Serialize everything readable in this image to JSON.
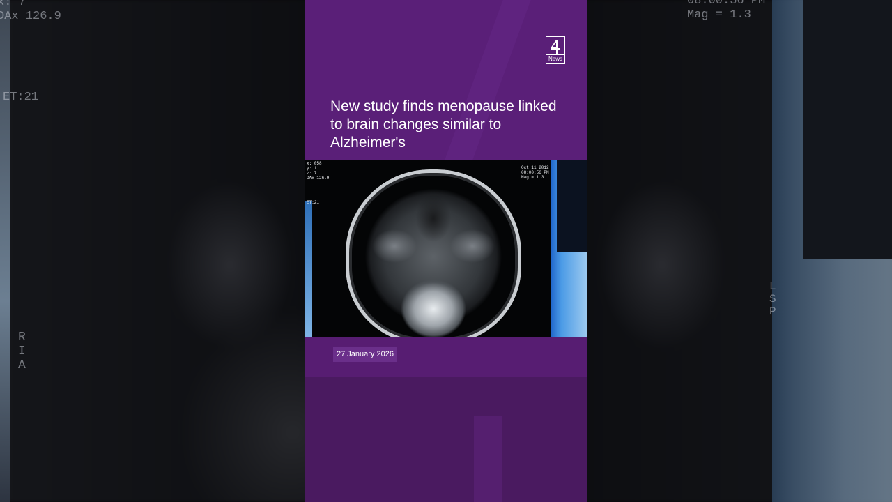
{
  "card": {
    "logo_text": "News",
    "headline": "New study finds menopause linked to brain changes similar to Alzheimer's",
    "date": "27 January 2026"
  },
  "image_overlay_text": {
    "top_left": "x: 058\ny: 11\nz: 7\nDAx 126.9",
    "left_mid": "ET:21",
    "top_right": "Oct 11 2012\n08:00:56 PM\nMag = 1.3"
  },
  "background_text": {
    "left_top": "x: 7\nDAx 126.9",
    "left_mid": "ET:21",
    "left_bottom": "R\nI\nA",
    "right_top": "08:00:56 PM\nMag = 1.3",
    "right_mid": "L\nS\nP"
  },
  "colors": {
    "card_purple": "#4a1a60",
    "header_purple": "#5a1f78",
    "badge_purple": "#6a2f8a"
  },
  "icons": {
    "logo": "channel-4-logo"
  }
}
